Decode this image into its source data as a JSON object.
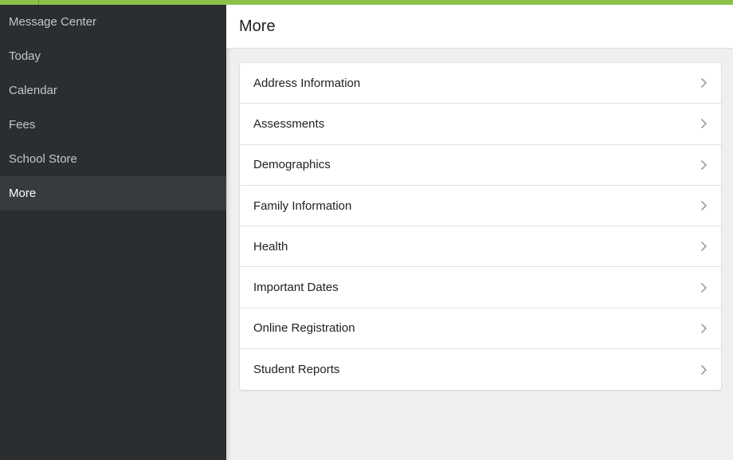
{
  "colors": {
    "accent": "#8bc34a",
    "sidebar_bg": "#2a2e31",
    "sidebar_active_bg": "#373b3e",
    "content_bg": "#efefef"
  },
  "sidebar": {
    "items": [
      {
        "label": "Message Center"
      },
      {
        "label": "Today"
      },
      {
        "label": "Calendar"
      },
      {
        "label": "Fees"
      },
      {
        "label": "School Store"
      },
      {
        "label": "More",
        "active": true
      }
    ]
  },
  "header": {
    "title": "More"
  },
  "more_list": {
    "items": [
      {
        "label": "Address Information",
        "icon": "chevron-right-icon"
      },
      {
        "label": "Assessments",
        "icon": "chevron-right-icon"
      },
      {
        "label": "Demographics",
        "icon": "chevron-right-icon"
      },
      {
        "label": "Family Information",
        "icon": "chevron-right-icon"
      },
      {
        "label": "Health",
        "icon": "chevron-right-icon"
      },
      {
        "label": "Important Dates",
        "icon": "chevron-right-icon"
      },
      {
        "label": "Online Registration",
        "icon": "chevron-right-icon"
      },
      {
        "label": "Student Reports",
        "icon": "chevron-right-icon"
      }
    ]
  }
}
